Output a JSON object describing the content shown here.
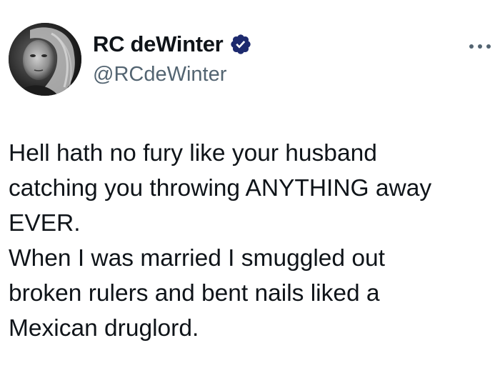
{
  "author": {
    "display_name": "RC deWinter",
    "handle": "@RCdeWinter",
    "avatar_icon": "avatar-photo",
    "verified_icon": "verified-badge-icon",
    "verified_color": "#1d2a6e"
  },
  "menu": {
    "icon": "more-options-icon"
  },
  "tweet": {
    "lines": [
      "Hell hath no fury like your husband",
      "catching you throwing ANYTHING away",
      "EVER.",
      "When I was married I smuggled out",
      "broken rulers and bent nails liked a",
      "Mexican druglord."
    ]
  },
  "colors": {
    "text": "#0f1419",
    "secondary": "#536471",
    "background": "#ffffff"
  }
}
